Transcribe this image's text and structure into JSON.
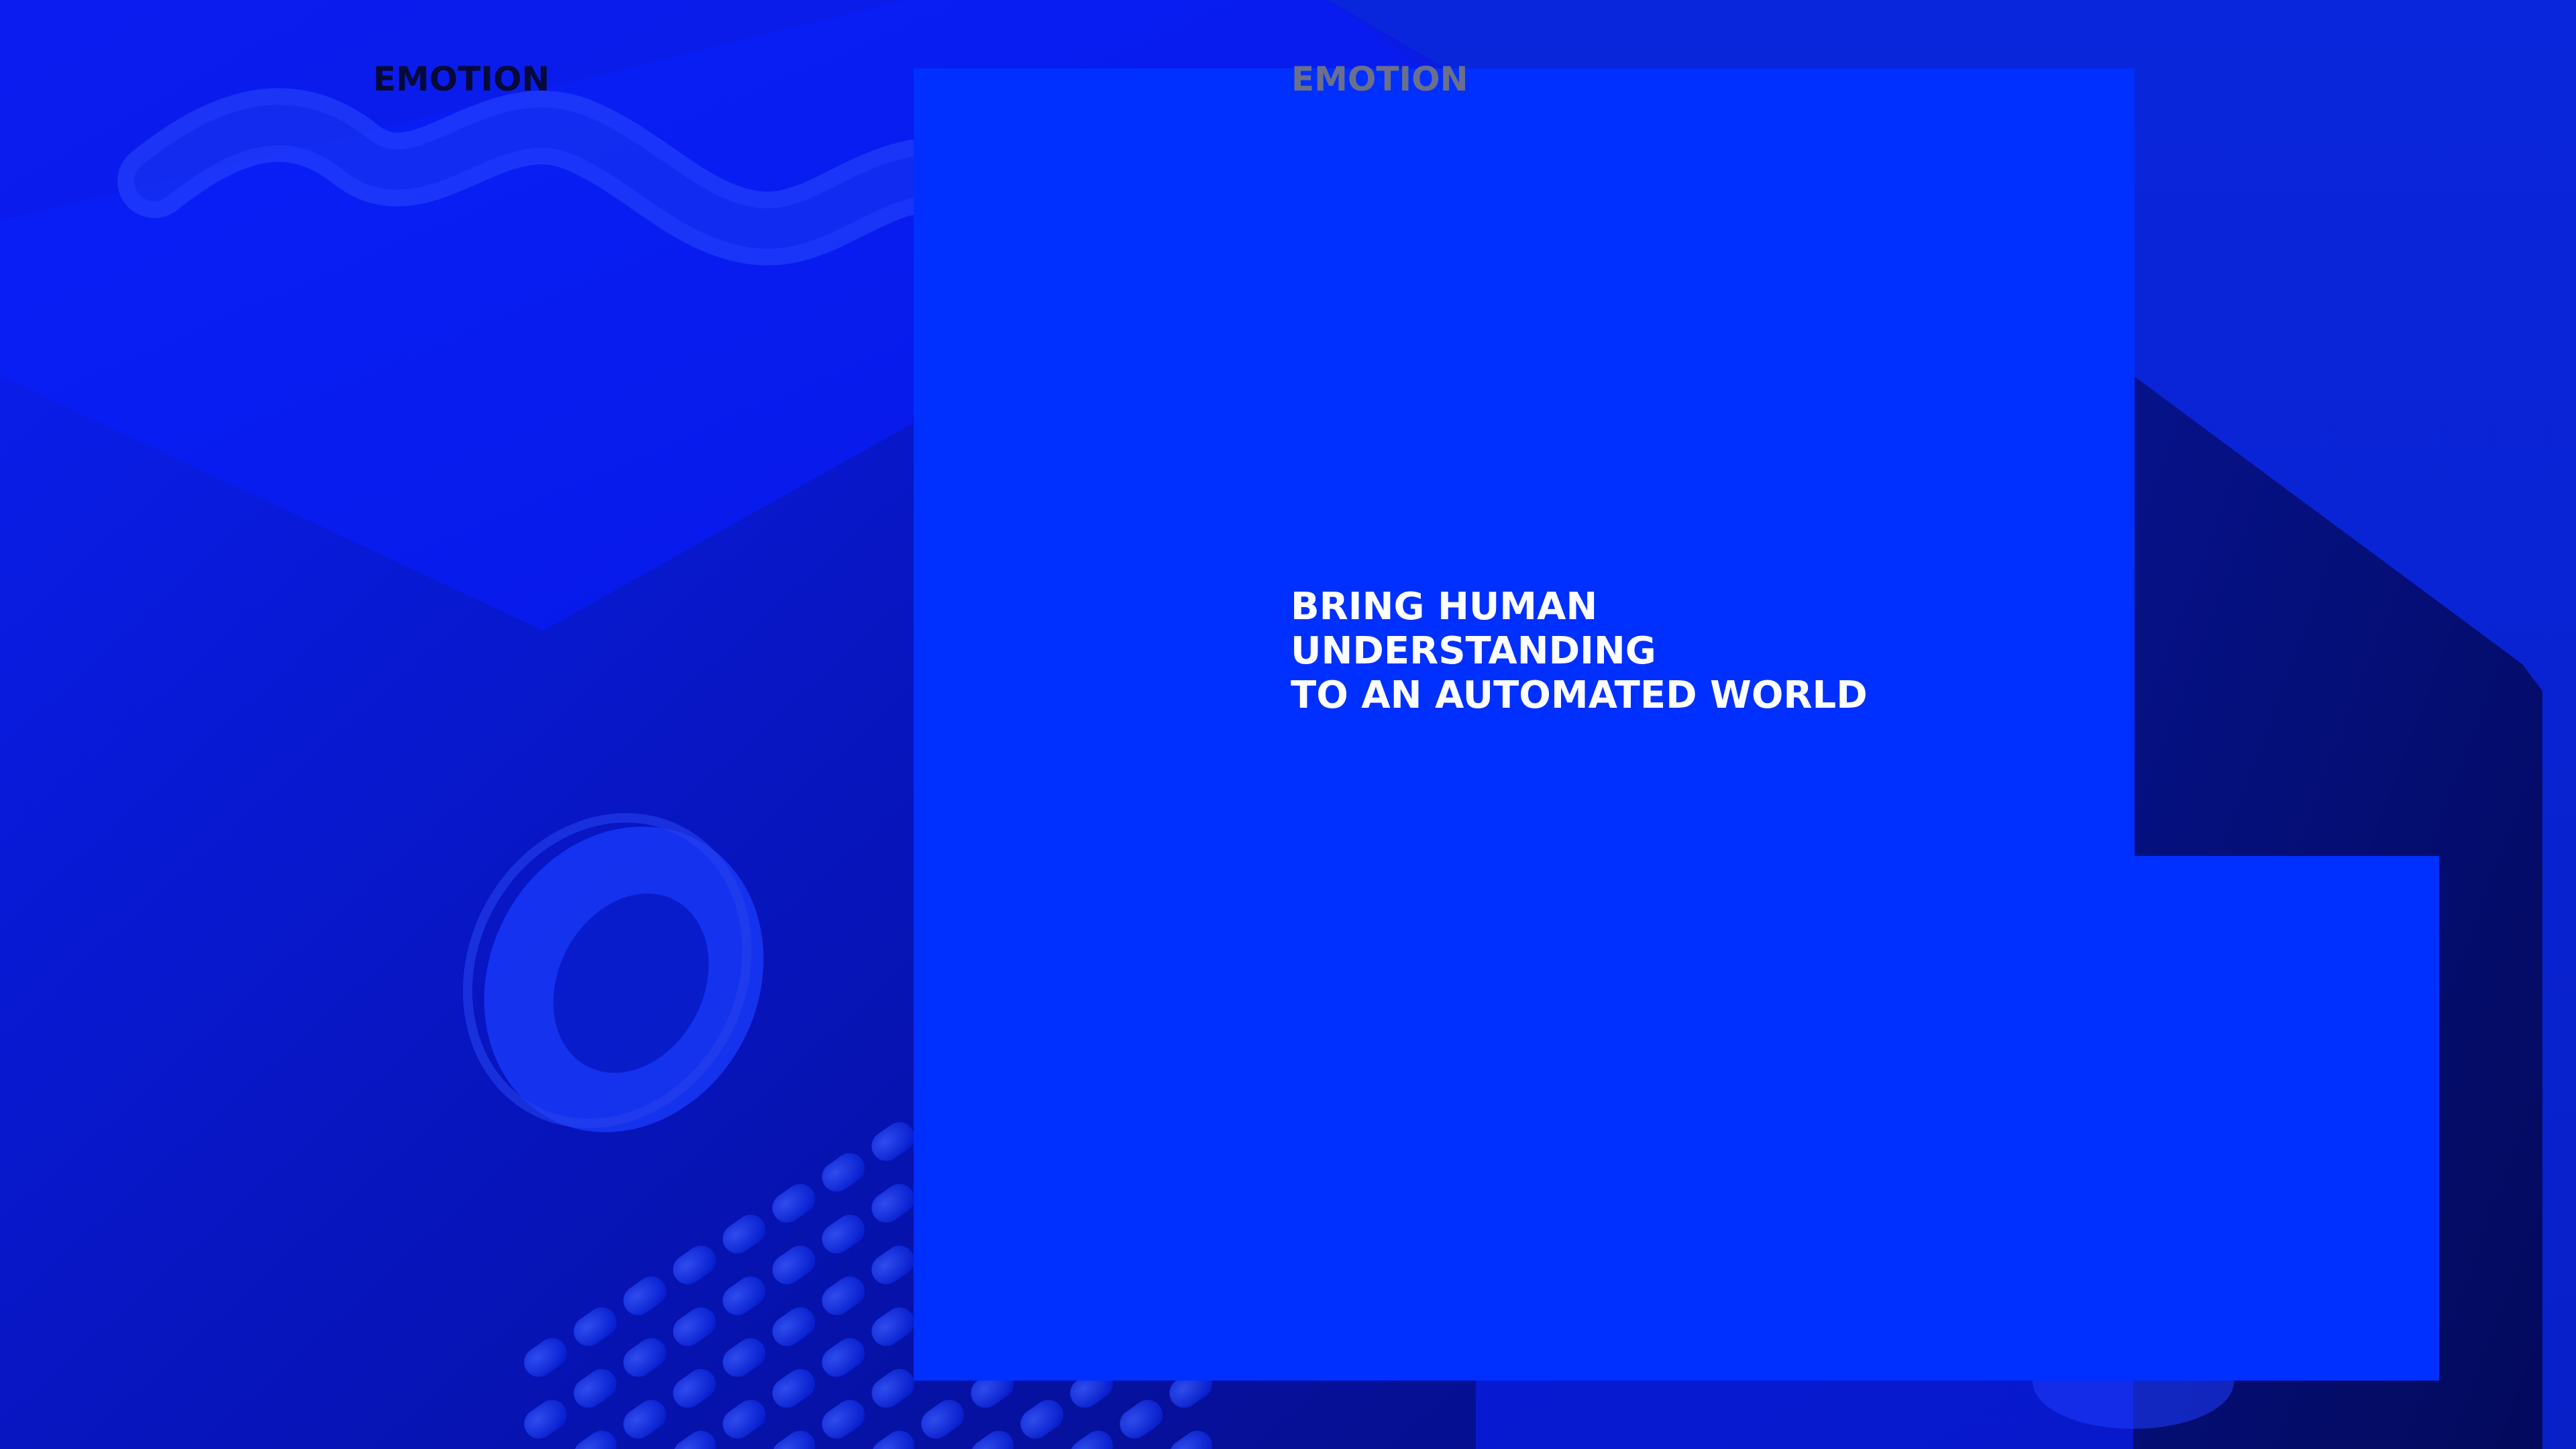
{
  "brand": {
    "left_label": "EMOTION",
    "right_label": "EMOTION"
  },
  "hero": {
    "headline_lines": [
      "BRING HUMAN",
      "UNDERSTANDING",
      "TO AN AUTOMATED WORLD"
    ]
  },
  "colors": {
    "background": "#0a24e8",
    "card": "#0030ff",
    "headline": "#ffffff",
    "brand_left": "#050a3a",
    "brand_right": "#6b6f8c"
  },
  "decorations": {
    "shapes": [
      "wave-tube-icon",
      "ring-icon",
      "bead-grid-icon",
      "cube-block-icon"
    ]
  }
}
